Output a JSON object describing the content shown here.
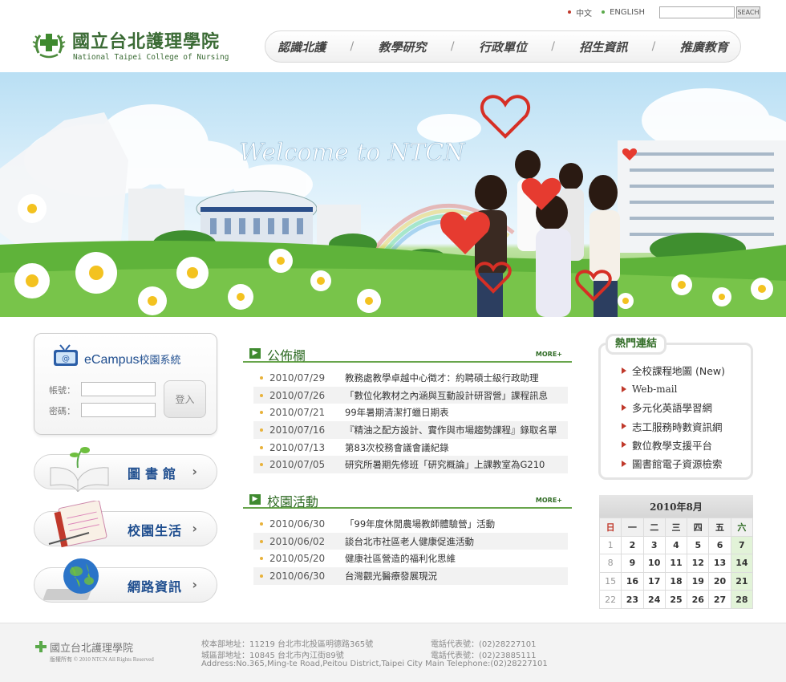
{
  "header": {
    "lang_zh": "中文",
    "lang_en": "ENGLISH",
    "search_button": "SEACH",
    "logo_zh": "國立台北護理學院",
    "logo_en": "National Taipei College of Nursing",
    "nav": [
      "認識北護",
      "教學研究",
      "行政單位",
      "招生資訊",
      "推廣教育"
    ]
  },
  "banner": {
    "welcome": "Welcome to NTCN"
  },
  "ecampus": {
    "title_en": "eCampus",
    "title_zh": "校園系統",
    "account_label": "帳號：",
    "password_label": "密碼：",
    "login_button": "登入"
  },
  "side_buttons": [
    {
      "label": "圖書館",
      "icon": "book-icon"
    },
    {
      "label": "校園生活",
      "icon": "notebook-icon"
    },
    {
      "label": "網路資訊",
      "icon": "globe-laptop-icon"
    }
  ],
  "announcements": {
    "title": "公佈欄",
    "more": "MORE+",
    "items": [
      {
        "date": "2010/07/29",
        "text": "教務處教學卓越中心徵才：約聘碩士級行政助理"
      },
      {
        "date": "2010/07/26",
        "text": "「數位化教材之內涵與互動設計研習營」課程訊息"
      },
      {
        "date": "2010/07/21",
        "text": "99年暑期清潔打蠟日期表"
      },
      {
        "date": "2010/07/16",
        "text": "『精油之配方設計、實作與市場趨勢課程』錄取名單"
      },
      {
        "date": "2010/07/13",
        "text": "第83次校務會議會議紀錄"
      },
      {
        "date": "2010/07/05",
        "text": "研究所暑期先修班「研究概論」上課教室為G210"
      }
    ]
  },
  "activities": {
    "title": "校園活動",
    "more": "MORE+",
    "items": [
      {
        "date": "2010/06/30",
        "text": "「99年度休閒農場教師體驗營」活動"
      },
      {
        "date": "2010/06/02",
        "text": "談台北市社區老人健康促進活動"
      },
      {
        "date": "2010/05/20",
        "text": "健康社區營造的福利化思維"
      },
      {
        "date": "2010/06/30",
        "text": "台灣觀光醫療發展現況"
      }
    ]
  },
  "hot_links": {
    "title": "熱門連結",
    "items": [
      "全校課程地圖 (New)",
      "Web-mail",
      "多元化英語學習網",
      "志工服務時數資訊網",
      "數位教學支援平台",
      "圖書館電子資源檢索"
    ]
  },
  "calendar": {
    "month": "2010年8月",
    "weekdays": [
      "日",
      "一",
      "二",
      "三",
      "四",
      "五",
      "六"
    ],
    "weeks": [
      [
        "1",
        "2",
        "3",
        "4",
        "5",
        "6",
        "7"
      ],
      [
        "8",
        "9",
        "10",
        "11",
        "12",
        "13",
        "14"
      ],
      [
        "15",
        "16",
        "17",
        "18",
        "19",
        "20",
        "21"
      ],
      [
        "22",
        "23",
        "24",
        "25",
        "26",
        "27",
        "28"
      ]
    ]
  },
  "footer": {
    "name": "國立台北護理學院",
    "copyright": "版權所有 © 2010 NTCN All Rights Reserved",
    "address1": "校本部地址：11219 台北市北投區明德路365號",
    "address2": "城區部地址：10845 台北市內江街89號",
    "address3": "Address:No.365,Ming-te Road,Peitou District,Taipei City  Main Telephone:(02)28227101",
    "tel1": "電話代表號：(02)28227101",
    "tel2": "電話代表號：(02)23885111"
  },
  "colors": {
    "brand_green": "#3b6b35",
    "section_green": "#68a54c",
    "link_blue": "#1f4e8f",
    "accent_red": "#c0392b"
  }
}
